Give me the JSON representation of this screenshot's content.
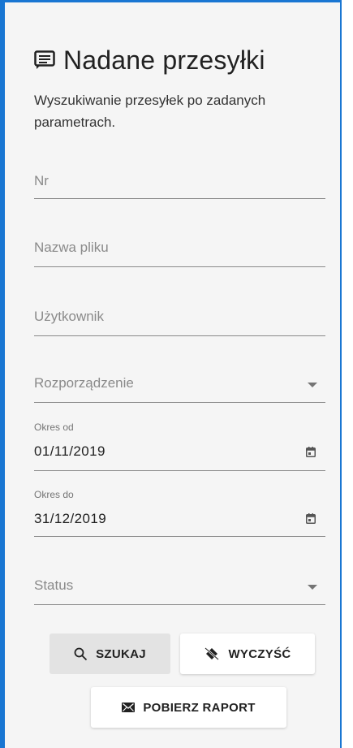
{
  "header": {
    "icon": "message-square-icon",
    "title": "Nadane przesyłki",
    "subtitle": "Wyszukiwanie przesyłek po zadanych parametrach."
  },
  "form": {
    "nr_placeholder": "Nr",
    "filename_placeholder": "Nazwa pliku",
    "user_placeholder": "Użytkownik",
    "regulation_placeholder": "Rozporządzenie",
    "date_from_label": "Okres od",
    "date_from_value": "01/11/2019",
    "date_to_label": "Okres do",
    "date_to_value": "31/12/2019",
    "status_placeholder": "Status"
  },
  "buttons": {
    "search": "SZUKAJ",
    "clear": "WYCZYŚĆ",
    "report": "POBIERZ RAPORT"
  },
  "colors": {
    "accent": "#1976d2",
    "panel_bg": "#f5f5f5"
  }
}
